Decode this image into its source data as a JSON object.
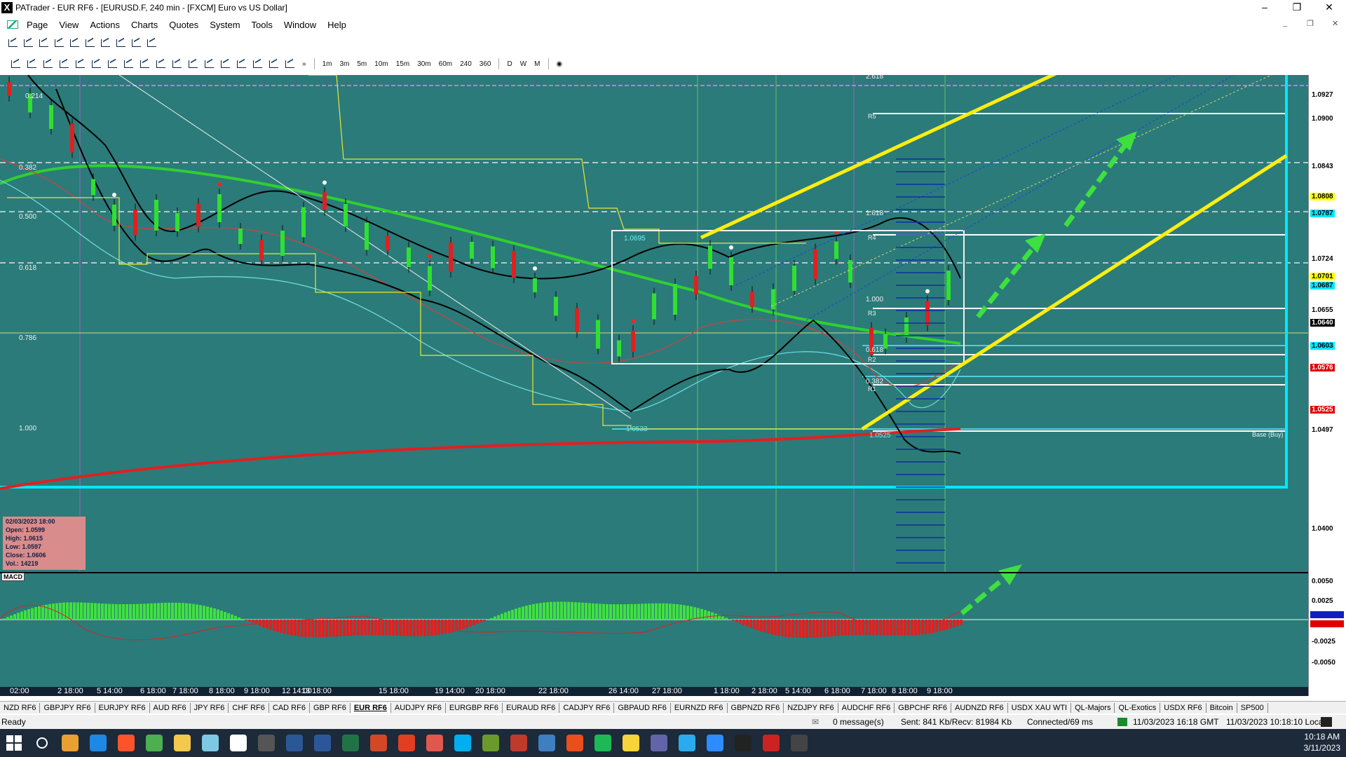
{
  "window": {
    "title": "PATrader - EUR RF6 - [EURUSD.F, 240 min - [FXCM] Euro vs US Dollar]"
  },
  "menu": [
    "Page",
    "View",
    "Actions",
    "Charts",
    "Quotes",
    "System",
    "Tools",
    "Window",
    "Help"
  ],
  "timeframes": [
    "1m",
    "3m",
    "5m",
    "10m",
    "15m",
    "30m",
    "60m",
    "240",
    "360",
    "D",
    "W",
    "M"
  ],
  "chart": {
    "symbol": "EURUSD.F",
    "fib_left_labels": [
      "0.214",
      "0.382",
      "0.500",
      "0.618",
      "0.786",
      "1.000"
    ],
    "fib_right_labels": [
      "2.618",
      "1.618",
      "1.000",
      "0.618",
      "0.382"
    ],
    "pivot_labels": [
      "R5",
      "R4",
      "R3",
      "R2",
      "R1",
      "Base (Buy)"
    ],
    "box_labels": {
      "top": "1.0695",
      "bottom": "1.0533",
      "inner": "1.0525"
    },
    "price_axis": [
      {
        "v": "1.0927",
        "bg": "#ffffff",
        "fg": "#000"
      },
      {
        "v": "1.0900",
        "bg": "#ffffff",
        "fg": "#000"
      },
      {
        "v": "1.0843",
        "bg": "#ffffff",
        "fg": "#000"
      },
      {
        "v": "1.0808",
        "bg": "#ffff00",
        "fg": "#000"
      },
      {
        "v": "1.0787",
        "bg": "#00e5ff",
        "fg": "#000"
      },
      {
        "v": "1.0724",
        "bg": "#ffffff",
        "fg": "#000"
      },
      {
        "v": "1.0701",
        "bg": "#ffff00",
        "fg": "#000"
      },
      {
        "v": "1.0687",
        "bg": "#00e5ff",
        "fg": "#000"
      },
      {
        "v": "1.0655",
        "bg": "#ffffff",
        "fg": "#000"
      },
      {
        "v": "1.0640",
        "bg": "#000000",
        "fg": "#fff"
      },
      {
        "v": "1.0603",
        "bg": "#00e5ff",
        "fg": "#000"
      },
      {
        "v": "1.0576",
        "bg": "#e00000",
        "fg": "#fff"
      },
      {
        "v": "1.0525",
        "bg": "#e00000",
        "fg": "#fff"
      },
      {
        "v": "1.0497",
        "bg": "#ffffff",
        "fg": "#000"
      },
      {
        "v": "1.0400",
        "bg": "#ffffff",
        "fg": "#000"
      }
    ],
    "macd_axis": [
      "0.0050",
      "0.0025",
      "-0.0025",
      "-0.0050"
    ],
    "info": {
      "date": "02/03/2023 18:00",
      "open": "Open: 1.0599",
      "high": "High: 1.0615",
      "low": "Low: 1.0597",
      "close": "Close: 1.0606",
      "vol": "Vol.: 14219"
    },
    "macd_label": "MACD",
    "dates": [
      "02:00",
      "2 18:00",
      "5 14:00",
      "6 18:00",
      "7 18:00",
      "8 18:00",
      "9 18:00",
      "12 14:00",
      "13 18:00",
      "15 18:00",
      "19 14:00",
      "20 18:00",
      "22 18:00",
      "26 14:00",
      "27 18:00",
      "1 18:00",
      "2 18:00",
      "5 14:00",
      "6 18:00",
      "7 18:00",
      "8 18:00",
      "9 18:00"
    ]
  },
  "symbol_tabs": [
    "NZD RF6",
    "GBPJPY RF6",
    "EURJPY RF6",
    "AUD RF6",
    "JPY RF6",
    "CHF RF6",
    "CAD RF6",
    "GBP RF6",
    "EUR RF6",
    "AUDJPY RF6",
    "EURGBP RF6",
    "EURAUD RF6",
    "CADJPY RF6",
    "GBPAUD RF6",
    "EURNZD RF6",
    "GBPNZD RF6",
    "NZDJPY RF6",
    "AUDCHF RF6",
    "GBPCHF RF6",
    "AUDNZD RF6",
    "USDX XAU WTI",
    "QL-Majors",
    "QL-Exotics",
    "USDX RF6",
    "Bitcoin",
    "SP500"
  ],
  "active_tab": "EUR RF6",
  "status": {
    "ready": "Ready",
    "messages": "0 message(s)",
    "traffic": "Sent: 841 Kb/Recv: 81984 Kb",
    "connection": "Connected/69 ms",
    "gmt": "11/03/2023 16:18 GMT",
    "local": "11/03/2023 10:18:10 Local"
  },
  "clock": {
    "time": "10:18 AM",
    "date": "3/11/2023"
  },
  "taskbar_icons": [
    "start-icon",
    "search-icon",
    "outlook-icon",
    "edge-icon",
    "brave-icon",
    "chrome-icon",
    "folder-icon",
    "notepad-icon",
    "patrader-icon",
    "calendar-icon",
    "calculator-icon",
    "word-icon",
    "excel-icon",
    "powerpoint-icon",
    "app-icon",
    "snagit-icon",
    "skype-icon",
    "ninja-icon",
    "bird-icon",
    "remote-icon",
    "camtasia-icon",
    "green-c-icon",
    "sticky-icon",
    "teams-icon",
    "telegram-icon",
    "zoom-icon",
    "tradingview-icon",
    "rec-icon",
    "obs-icon"
  ]
}
